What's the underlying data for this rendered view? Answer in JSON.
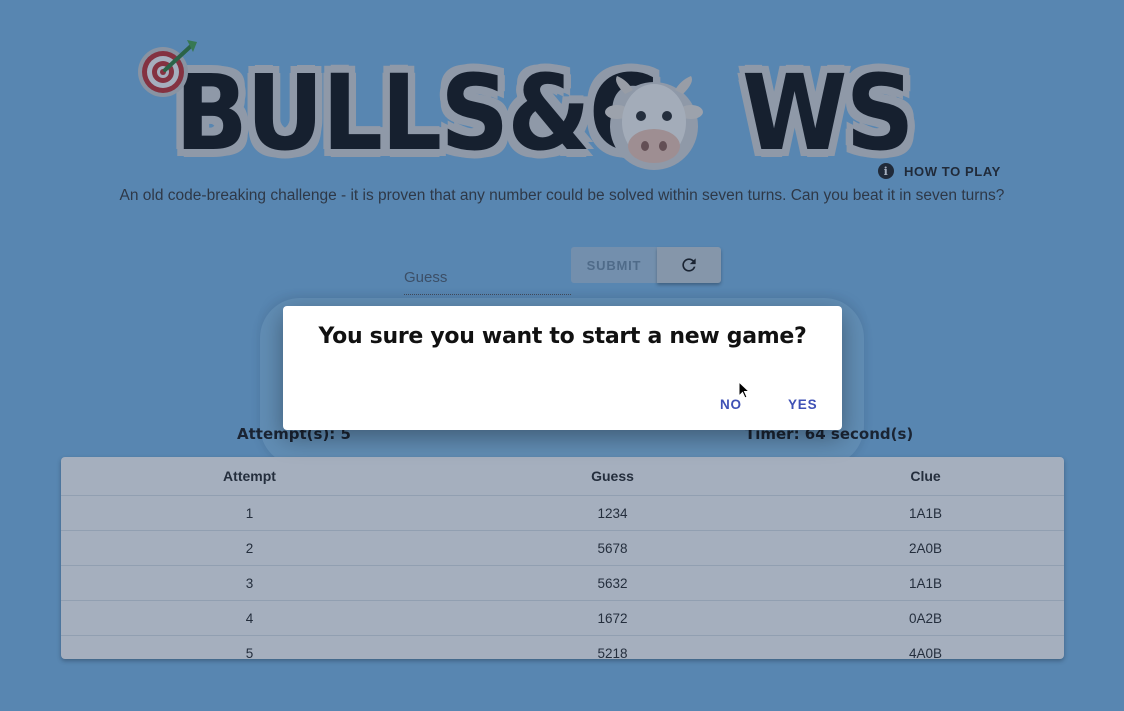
{
  "header": {
    "logo_text": "BULLS&C WS",
    "logo_left": "BULLS&C",
    "logo_right": "WS",
    "how_to_play": "HOW TO PLAY",
    "subtitle": "An old code-breaking challenge - it is proven that any number could be solved within seven turns. Can you beat it in seven turns?"
  },
  "guess": {
    "placeholder": "Guess",
    "value": "",
    "submit_label": "SUBMIT"
  },
  "stats": {
    "attempts": "Attempt(s): 5",
    "timer": "Timer: 64 second(s)"
  },
  "history": {
    "columns": [
      "Attempt",
      "Guess",
      "Clue"
    ],
    "rows": [
      [
        "1",
        "1234",
        "1A1B"
      ],
      [
        "2",
        "5678",
        "2A0B"
      ],
      [
        "3",
        "5632",
        "1A1B"
      ],
      [
        "4",
        "1672",
        "0A2B"
      ],
      [
        "5",
        "5218",
        "4A0B"
      ]
    ]
  },
  "dialog": {
    "title": "You sure you want to start a new game?",
    "no_label": "NO",
    "yes_label": "YES"
  },
  "colors": {
    "background": "#7ab8e8",
    "accent": "#3f51b5",
    "submit_disabled": "#a9c9e2"
  },
  "icons": {
    "target": "target-dart-icon",
    "cow": "cow-face-icon",
    "info": "info-icon",
    "reset": "refresh-icon"
  }
}
